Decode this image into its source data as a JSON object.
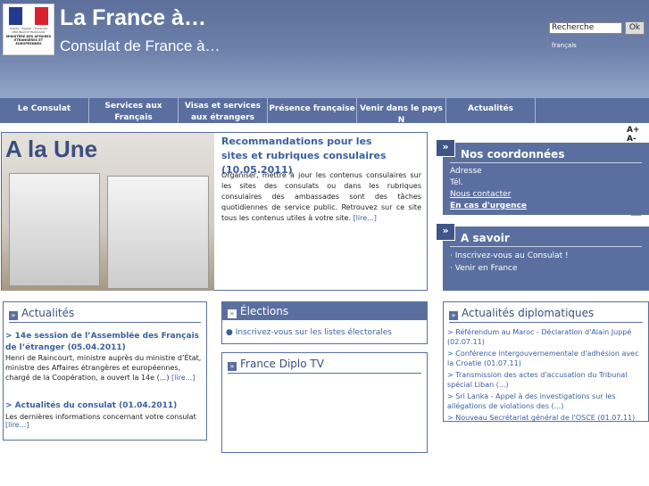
{
  "header": {
    "logo_motto": "Liberté • Égalité • Fraternité RÉPUBLIQUE FRANÇAISE",
    "logo_ministry": "MINISTÈRE DES AFFAIRES ÉTRANGÈRES ET EUROPÉENNES",
    "title": "La France à…",
    "subtitle": "Consulat de France à…",
    "search_value": "Recherche",
    "search_button": "Ok",
    "language": "français"
  },
  "nav": {
    "items": [
      "Le Consulat",
      "Services aux Français",
      "Visas et services aux étrangers",
      "Présence française",
      "Venir dans le pays N",
      "Actualités"
    ]
  },
  "font_size_controls": "A+ A-",
  "une": {
    "label": "A la Une",
    "headline": "Recommandations pour les sites et rubriques consulaires (10.05.2011)",
    "text": "Organiser, mettre à jour les contenus consulaires sur les sites des consulats ou dans les rubriques consulaires des ambassades sont des tâches quotidiennes de service public. Retrouvez sur ce site tous les contenus utiles à votre site.",
    "more": "[lire...]"
  },
  "coordonnees": {
    "title": "Nos coordonnées",
    "lines": [
      "Adresse",
      "Tél.",
      "Nous contacter",
      "En cas d'urgence"
    ]
  },
  "a_savoir": {
    "title": "A savoir",
    "items": [
      "Inscrivez-vous au Consulat !",
      "Venir en France"
    ]
  },
  "actualites": {
    "title": "Actualités",
    "items": [
      {
        "title": "> 14e session de l’Assemblée des Français de l’étranger (05.04.2011)",
        "text": "Henri de Raincourt, ministre auprès du ministre d’État, ministre des Affaires étrangères et européennes, chargé de la Coopération, a ouvert la 14e (...)",
        "more": "[lire...]"
      },
      {
        "title": "> Actualités du consulat (01.04.2011)",
        "text": "Les dernières informations concernant votre consulat",
        "more": "[lire...]"
      }
    ]
  },
  "elections": {
    "title": "Élections",
    "item": "Inscrivez-vous sur les listes électorales"
  },
  "diplotv": {
    "title": "France Diplo TV"
  },
  "diplo": {
    "title": "Actualités diplomatiques",
    "items": [
      "> Référendum au Maroc - Déclaration d'Alain Juppé (02.07.11)",
      "> Conférence intergouvernementale d'adhésion avec la Croatie (01.07.11)",
      "> Transmission des actes d'accusation du Tribunal spécial Liban (...)",
      "> Sri Lanka - Appel à des investigations sur les allégations de violations des (...)",
      "> Nouveau Secrétariat général de l'OSCE (01.07.11)"
    ]
  },
  "colors": {
    "brand": "#5a6f9f",
    "link": "#3a5fa0"
  }
}
